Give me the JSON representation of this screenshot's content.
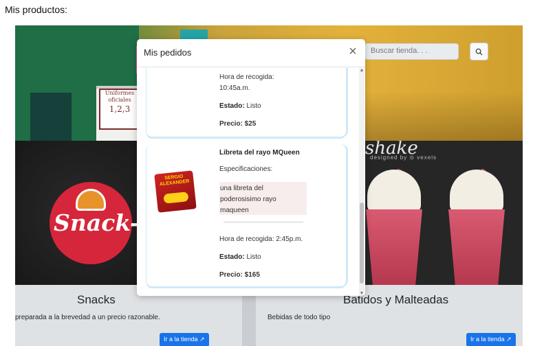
{
  "doc_title": "Mis productos:",
  "search": {
    "placeholder": "Buscar tienda. . ."
  },
  "hero": {
    "sign_lines": [
      "Uniformes",
      "oficiales",
      "1,2,3"
    ]
  },
  "cards": [
    {
      "title": "Snacks",
      "text": "preparada a la brevedad a un precio razonable.",
      "button": "Ir a la tienda ↗",
      "logo_text": "Snack-G"
    },
    {
      "title": "Batidos y Malteadas",
      "text": "Bebidas de todo tipo",
      "button": "Ir a la tienda ↗",
      "banner_text": "Milkshake",
      "credit": "designed by ⊙ vexels"
    }
  ],
  "modal": {
    "title": "Mis pedidos",
    "close": "×",
    "orders": [
      {
        "pickup": "Hora de recogida: 10:45a.m.",
        "status_label": "Estado:",
        "status": "Listo",
        "price": "Precio: $25"
      },
      {
        "name": "Libreta del rayo MQueen",
        "spec_label": "Especificaciones:",
        "spec": "una libreta del poderosisimo rayo maqueen",
        "image_text": "SERGIO ALEXANDER",
        "pickup": "Hora de recogida: 2:45p.m.",
        "status_label": "Estado:",
        "status": "Listo",
        "price": "Precio: $165"
      }
    ]
  },
  "colors": {
    "primary": "#1a73e8",
    "spec_bg": "#f8eded",
    "card_border": "#cfe8f7"
  }
}
